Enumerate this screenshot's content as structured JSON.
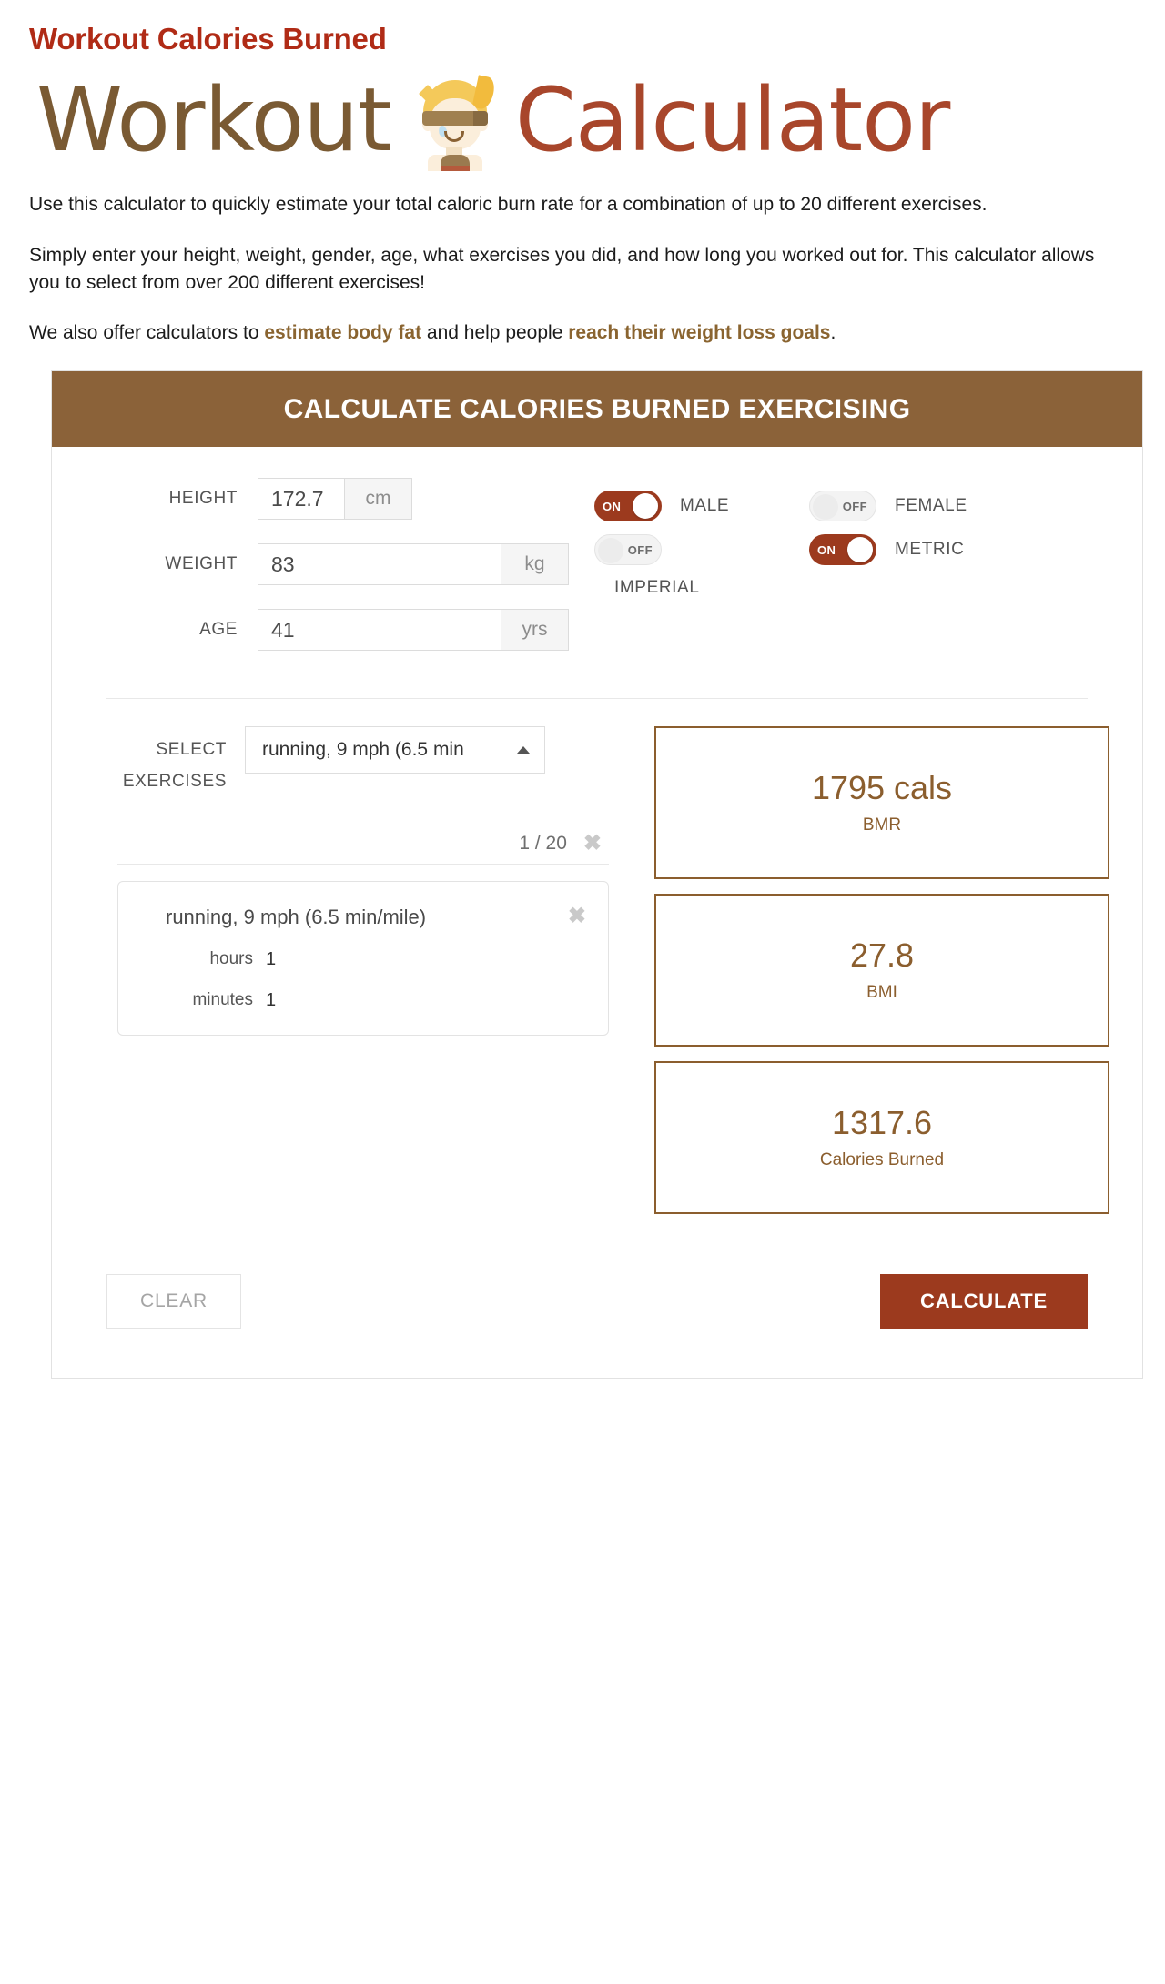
{
  "page_title": "Workout Calories Burned",
  "logo": {
    "word_1": "Workout",
    "word_2": "Calculator",
    "mascot_icon": "workout-mascot-icon"
  },
  "intro": {
    "p1": "Use this calculator to quickly estimate your total caloric burn rate for a combination of up to 20 different exercises.",
    "p2": "Simply enter your height, weight, gender, age, what exercises you did, and how long you worked out for. This calculator allows you to select from over 200 different exercises!",
    "p3_before": "We also offer calculators to ",
    "p3_link1": "estimate body fat",
    "p3_middle": " and help people ",
    "p3_link2": "reach their weight loss goals",
    "p3_after": "."
  },
  "calculator": {
    "header": "CALCULATE CALORIES BURNED EXERCISING",
    "fields": {
      "height": {
        "label": "HEIGHT",
        "value": "172.7",
        "unit": "cm"
      },
      "weight": {
        "label": "WEIGHT",
        "value": "83",
        "unit": "kg"
      },
      "age": {
        "label": "AGE",
        "value": "41",
        "unit": "yrs"
      }
    },
    "toggles": {
      "male": {
        "state": "ON",
        "label": "MALE",
        "on": true
      },
      "female": {
        "state": "OFF",
        "label": "FEMALE",
        "on": false
      },
      "imperial": {
        "state": "OFF",
        "label": "IMPERIAL",
        "on": false
      },
      "metric": {
        "state": "ON",
        "label": "METRIC",
        "on": true
      }
    },
    "exercises": {
      "select_label_line1": "SELECT",
      "select_label_line2": "EXERCISES",
      "selected_option": "running, 9 mph (6.5 min",
      "counter": "1 / 20",
      "remove_all_icon": "close-icon",
      "card": {
        "title": "running, 9 mph (6.5 min/mile)",
        "remove_icon": "close-icon",
        "hours_label": "hours",
        "hours_value": "1",
        "minutes_label": "minutes",
        "minutes_value": "1"
      }
    },
    "results": [
      {
        "value": "1795 cals",
        "label": "BMR"
      },
      {
        "value": "27.8",
        "label": "BMI"
      },
      {
        "value": "1317.6",
        "label": "Calories Burned"
      }
    ],
    "buttons": {
      "clear": "CLEAR",
      "calculate": "CALCULATE"
    }
  },
  "colors": {
    "title_red": "#b02b16",
    "logo_brown": "#7a5a33",
    "logo_rust": "#a8462b",
    "header_brown": "#8b6239",
    "accent_red": "#9c3a1e",
    "result_brown": "#8b5e2e",
    "link_brown": "#8a6430"
  }
}
